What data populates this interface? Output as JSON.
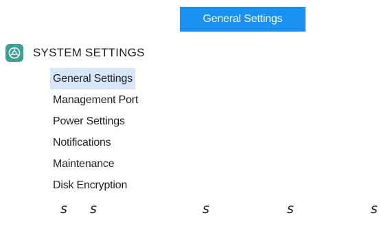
{
  "header": {
    "badge_label": "General Settings"
  },
  "section": {
    "title": "SYSTEM SETTINGS",
    "icon": "settings-gear-icon",
    "icon_color": "#3d9e94"
  },
  "menu": {
    "items": [
      {
        "label": "General Settings",
        "selected": true
      },
      {
        "label": "Management Port",
        "selected": false
      },
      {
        "label": "Power Settings",
        "selected": false
      },
      {
        "label": "Notifications",
        "selected": false
      },
      {
        "label": "Maintenance",
        "selected": false
      },
      {
        "label": "Disk Encryption",
        "selected": false
      }
    ],
    "selected_bg": "#d6e7fb"
  },
  "footer_glyphs": [
    "s",
    "s",
    "s",
    "s",
    "s"
  ],
  "accent_color": "#1a90f0"
}
